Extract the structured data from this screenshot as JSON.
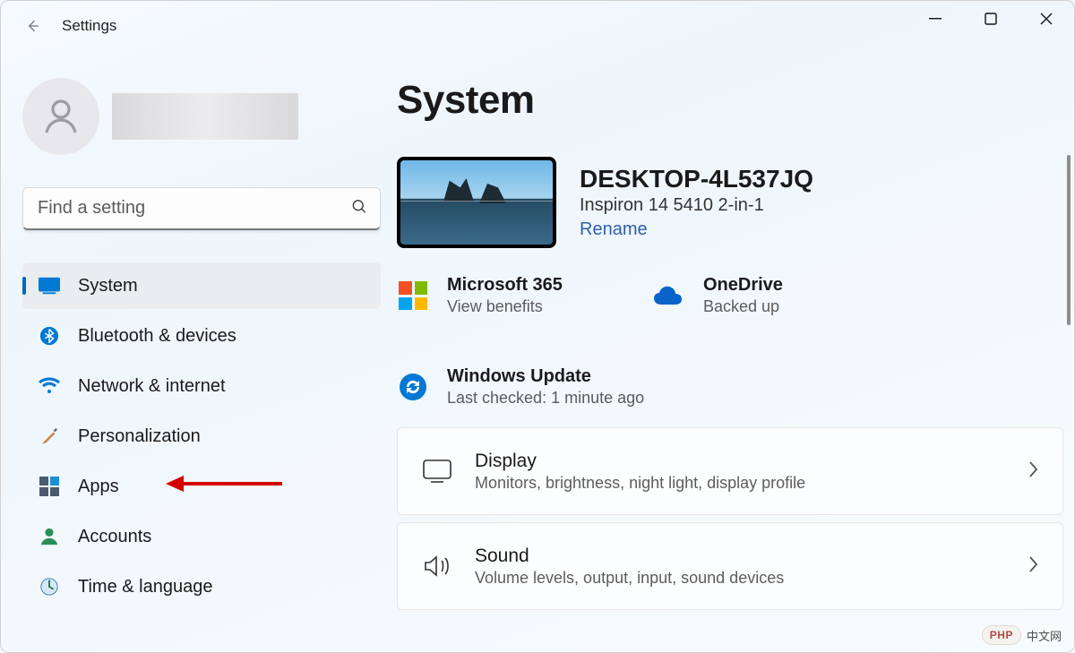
{
  "app": {
    "title": "Settings"
  },
  "search": {
    "placeholder": "Find a setting"
  },
  "sidebar": {
    "items": [
      {
        "label": "System"
      },
      {
        "label": "Bluetooth & devices"
      },
      {
        "label": "Network & internet"
      },
      {
        "label": "Personalization"
      },
      {
        "label": "Apps"
      },
      {
        "label": "Accounts"
      },
      {
        "label": "Time & language"
      }
    ]
  },
  "page": {
    "title": "System"
  },
  "device": {
    "name": "DESKTOP-4L537JQ",
    "model": "Inspiron 14 5410 2-in-1",
    "rename": "Rename"
  },
  "tiles": {
    "m365": {
      "title": "Microsoft 365",
      "sub": "View benefits"
    },
    "onedrive": {
      "title": "OneDrive",
      "sub": "Backed up"
    },
    "update": {
      "title": "Windows Update",
      "sub": "Last checked: 1 minute ago"
    }
  },
  "cards": {
    "display": {
      "title": "Display",
      "sub": "Monitors, brightness, night light, display profile"
    },
    "sound": {
      "title": "Sound",
      "sub": "Volume levels, output, input, sound devices"
    }
  },
  "watermark": {
    "badge": "PHP",
    "text": "中文网"
  }
}
